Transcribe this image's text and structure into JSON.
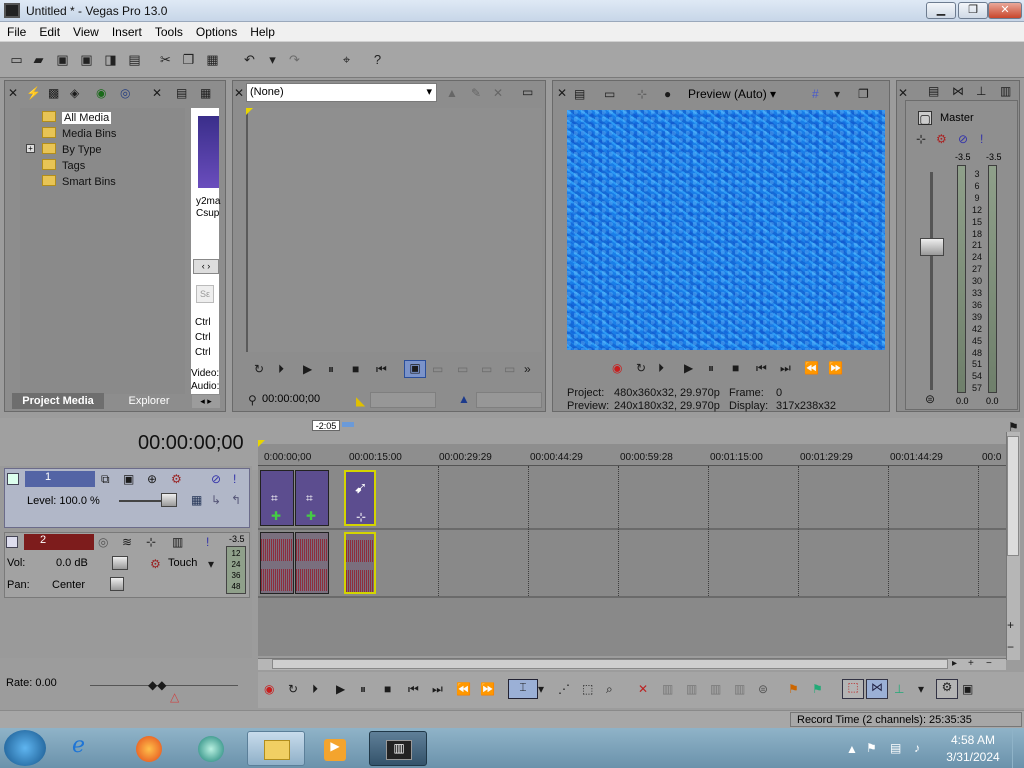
{
  "window": {
    "title": "Untitled * - Vegas Pro 13.0",
    "minimize": "▁",
    "maximize": "❐",
    "close": "✕"
  },
  "menu": [
    "File",
    "Edit",
    "View",
    "Insert",
    "Tools",
    "Options",
    "Help"
  ],
  "toolbar_icons": [
    "new-icon",
    "open-icon",
    "save-icon",
    "save-as-icon",
    "render-icon",
    "properties-icon",
    "cut-icon",
    "copy-icon",
    "paste-icon",
    "undo-icon",
    "redo-icon",
    "enable-snapping-icon",
    "whats-this-help-icon"
  ],
  "project_media": {
    "tree": [
      {
        "label": "All Media",
        "selected": true
      },
      {
        "label": "Media Bins"
      },
      {
        "label": "By Type",
        "expander": "+"
      },
      {
        "label": "Tags"
      },
      {
        "label": "Smart Bins"
      }
    ],
    "thumb_caption_1": "y2ma",
    "thumb_caption_2": "Csup",
    "shortcut_1": "Ctrl",
    "shortcut_2": "Ctrl",
    "shortcut_3": "Ctrl",
    "video_label": "Video:",
    "audio_label": "Audio:",
    "tabs": [
      "Project Media",
      "Explorer"
    ]
  },
  "trimmer": {
    "select_value": "(None)",
    "timecode": "00:00:00;00"
  },
  "preview": {
    "mode_label": "Preview (Auto)",
    "project_label": "Project:",
    "project_value": "480x360x32, 29.970p",
    "preview_label": "Preview:",
    "preview_value": "240x180x32, 29.970p",
    "frame_label": "Frame:",
    "frame_value": "0",
    "display_label": "Display:",
    "display_value": "317x238x32"
  },
  "mixer": {
    "label": "Master",
    "peak_left": "-3.5",
    "peak_right": "-3.5",
    "scale": [
      "3",
      "6",
      "9",
      "12",
      "15",
      "18",
      "21",
      "24",
      "27",
      "30",
      "33",
      "36",
      "39",
      "42",
      "45",
      "48",
      "51",
      "54",
      "57"
    ],
    "fader_left": "0.0",
    "fader_right": "0.0"
  },
  "timeline": {
    "timecode": "00:00:00;00",
    "cursor_marker": "-2:05",
    "ruler": [
      "0:00:00;00",
      "00:00:15:00",
      "00:00:29:29",
      "00:00:44:29",
      "00:00:59:28",
      "00:01:15:00",
      "00:01:29:29",
      "00:01:44:29",
      "00:0"
    ],
    "video_track": {
      "number": "1",
      "level_label": "Level: 100.0 %"
    },
    "audio_track": {
      "number": "2",
      "vol_label": "Vol:",
      "vol_value": "0.0 dB",
      "pan_label": "Pan:",
      "pan_value": "Center",
      "automation": "Touch",
      "peak": "-3.5",
      "meter_marks": [
        "12",
        "24",
        "36",
        "48"
      ]
    },
    "rate_label": "Rate: 0.00"
  },
  "status": {
    "record_time": "Record Time (2 channels): 25:35:35"
  },
  "taskbar": {
    "apps": [
      "windows-explorer",
      "vegas-pro"
    ],
    "time": "4:58 AM",
    "date": "3/31/2024"
  },
  "colors": {
    "accent_blue": "#1e86ee",
    "video_clip": "#5c4d8f",
    "audio_wave": "#8e2d3c",
    "record_red": "#d02020"
  }
}
